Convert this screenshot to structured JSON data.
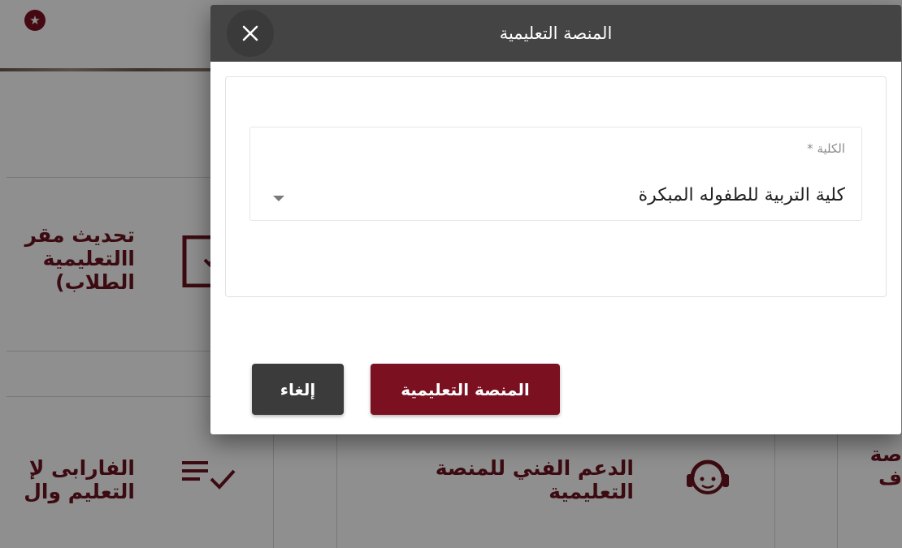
{
  "background": {
    "cards": [
      {
        "title": "تحديث مقر\nاالتعليمية\nالطلاب)"
      },
      {
        "title": "الفارابى لإ\nالتعليم وال"
      },
      {
        "title": "الدعم الفني للمنصة\nالتعليمية"
      },
      {
        "title": "صة\nف"
      }
    ]
  },
  "modal": {
    "title": "المنصة التعليمية",
    "close_icon": "close-icon",
    "field": {
      "label": "الكلية *",
      "value": "كلية التربية للطفوله المبكرة",
      "icon": "dropdown-arrow-icon"
    },
    "primary_button": "المنصة التعليمية",
    "cancel_button": "إلغاء"
  },
  "colors": {
    "header_bg": "#444444",
    "primary": "#7a1020",
    "cancel": "#3b3b3b",
    "accent_text": "#6b1420"
  }
}
